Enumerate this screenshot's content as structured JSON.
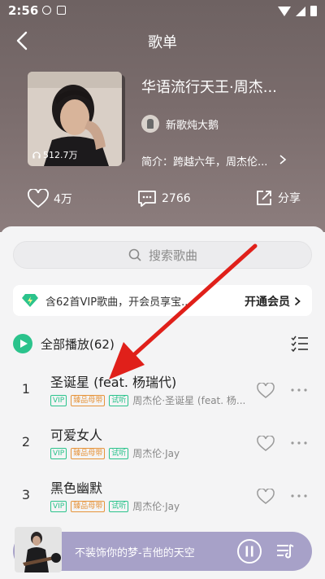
{
  "status_bar": {
    "time": "2:56"
  },
  "header": {
    "title": "歌单",
    "playlist_title": "华语流行天王·周杰...",
    "play_count": "512.7万",
    "creator": "新歌炖大鹅",
    "intro": "简介：跨越六年，周杰伦...",
    "likes": "4万",
    "comments": "2766",
    "share": "分享"
  },
  "search": {
    "placeholder": "搜索歌曲"
  },
  "vip_banner": {
    "text": "含62首VIP歌曲，开会员享宝...",
    "button": "开通会员"
  },
  "play_all": {
    "label": "全部播放(62)"
  },
  "tags": {
    "vip": "VIP",
    "hifi": "臻品母带",
    "trial": "试听"
  },
  "songs": [
    {
      "index": "1",
      "title": "圣诞星 (feat. 杨瑞代)",
      "meta": "周杰伦·圣诞星 (feat. 杨..."
    },
    {
      "index": "2",
      "title": "可爱女人",
      "meta": "周杰伦·Jay"
    },
    {
      "index": "3",
      "title": "黑色幽默",
      "meta": "周杰伦·Jay"
    }
  ],
  "mini_player": {
    "text": "不装饰你的梦-吉他的天空"
  },
  "colors": {
    "accent": "#2bc38c",
    "arrow": "#e0201a",
    "header": "#7a6c6c"
  }
}
